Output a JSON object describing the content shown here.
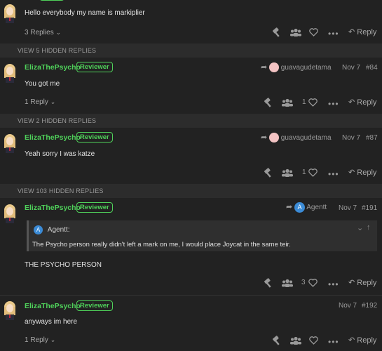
{
  "posts": [
    {
      "text": "Hello everybody my name is markiplier",
      "replies": "3 Replies",
      "reply_label": "Reply"
    },
    {
      "username": "ElizaThePsycho",
      "badge": "Reviewer",
      "reply_to": "guavagudetama",
      "date": "Nov 7",
      "number": "#84",
      "text": "You got me",
      "replies": "1 Reply",
      "likes": "1",
      "reply_label": "Reply"
    },
    {
      "username": "ElizaThePsycho",
      "badge": "Reviewer",
      "reply_to": "guavagudetama",
      "date": "Nov 7",
      "number": "#87",
      "text": "Yeah sorry I was katze",
      "likes": "1",
      "reply_label": "Reply"
    },
    {
      "username": "ElizaThePsycho",
      "badge": "Reviewer",
      "reply_to": "Agentt",
      "reply_to_avatar": "A",
      "date": "Nov 7",
      "number": "#191",
      "quote_author": "Agentt:",
      "quote_text": "The Psycho person really didn't left a mark on me, I would place Joycat in the same teir.",
      "text": "THE PSYCHO PERSON",
      "likes": "3",
      "reply_label": "Reply"
    },
    {
      "username": "ElizaThePsycho",
      "badge": "Reviewer",
      "date": "Nov 7",
      "number": "#192",
      "text": "anyways im here",
      "replies": "1 Reply",
      "reply_label": "Reply"
    }
  ],
  "hidden_bars": [
    "VIEW 5 HIDDEN REPLIES",
    "VIEW 2 HIDDEN REPLIES",
    "VIEW 103 HIDDEN REPLIES"
  ],
  "colors": {
    "background": "#222222",
    "username": "#4fd15a",
    "muted": "#9a9a9a",
    "accent_avatar": "#3b8bd6"
  }
}
